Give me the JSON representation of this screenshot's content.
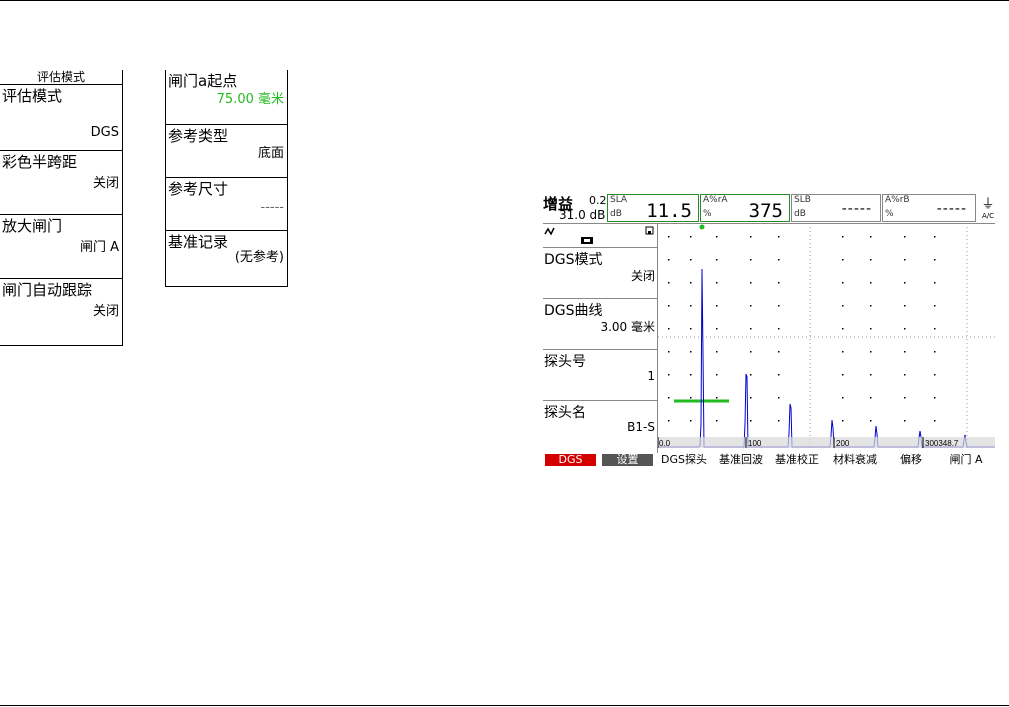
{
  "menu_eval": {
    "title": "评估模式",
    "items": [
      {
        "label": "评估模式",
        "value": "DGS"
      },
      {
        "label": "彩色半跨距",
        "value": "关闭"
      },
      {
        "label": "放大闸门",
        "value": "闸门 A"
      },
      {
        "label": "闸门自动跟踪",
        "value": "关闭"
      }
    ]
  },
  "menu_ref": {
    "items": [
      {
        "label": "闸门a起点",
        "value": "75.00 毫米",
        "value_color": "#22bb22"
      },
      {
        "label": "参考类型",
        "value": "底面"
      },
      {
        "label": "参考尺寸",
        "value": "-----"
      },
      {
        "label": "基准记录",
        "value": "(无参考)"
      }
    ]
  },
  "instrument": {
    "gain_label": "增益",
    "gain_step": "0.2",
    "gain_db": "31.0 dB",
    "readings": [
      {
        "line1": "SLA",
        "line2": "dB",
        "value": "11.5"
      },
      {
        "line1": "A%rA",
        "line2": "%",
        "value": "375"
      },
      {
        "line1": "SLB",
        "line2": "dB",
        "value": "-----"
      },
      {
        "line1": "A%rB",
        "line2": "%",
        "value": "-----"
      }
    ],
    "plug_label": "A/C",
    "side_items": [
      {
        "label": "DGS模式",
        "value": "关闭"
      },
      {
        "label": "DGS曲线",
        "value": "3.00 毫米"
      },
      {
        "label": "探头号",
        "value": "1"
      },
      {
        "label": "探头名",
        "value": "B1-S"
      }
    ],
    "scale_labels": [
      "0.0",
      "100",
      "200",
      "300348.7"
    ],
    "bottom_buttons": [
      "DGS",
      "设置",
      "DGS探头",
      "基准回波",
      "基准校正",
      "材料衰减",
      "偏移",
      "闸门 A"
    ]
  },
  "colors": {
    "accent_green": "#22bb22",
    "echo_blue": "#0000cc",
    "active_red": "#d40000"
  }
}
